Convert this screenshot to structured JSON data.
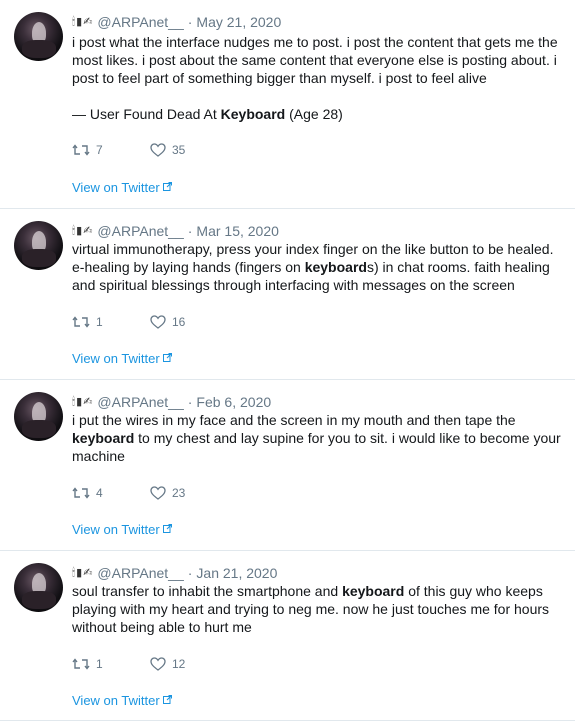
{
  "tweets": [
    {
      "handle": "@ARPAnet__",
      "separator": "·",
      "date": "May 21, 2020",
      "emoji_icons": [
        "candle-icon",
        "battery-icon",
        "tape-icon"
      ],
      "paragraphs": [
        [
          {
            "t": "i post what the interface nudges me to post. i post the content that gets me the most likes. i post about the same content that everyone else is posting about. i post to feel part of something bigger than myself. i post to feel alive"
          }
        ],
        [
          {
            "t": "— User Found Dead At "
          },
          {
            "t": "Keyboard",
            "b": true
          },
          {
            "t": " (Age 28)"
          }
        ]
      ],
      "retweets": "7",
      "likes": "35",
      "view_link": "View on Twitter"
    },
    {
      "handle": "@ARPAnet__",
      "separator": "·",
      "date": "Mar 15, 2020",
      "emoji_icons": [
        "candle-icon",
        "battery-icon",
        "tape-icon"
      ],
      "paragraphs": [
        [
          {
            "t": "virtual immunotherapy, press your index finger on the like button to be healed. e-healing by laying hands (fingers on "
          },
          {
            "t": "keyboard",
            "b": true
          },
          {
            "t": "s) in chat rooms. faith healing and spiritual blessings through interfacing with messages on the screen"
          }
        ]
      ],
      "retweets": "1",
      "likes": "16",
      "view_link": "View on Twitter"
    },
    {
      "handle": "@ARPAnet__",
      "separator": "·",
      "date": "Feb 6, 2020",
      "emoji_icons": [
        "candle-icon",
        "battery-icon",
        "tape-icon"
      ],
      "paragraphs": [
        [
          {
            "t": "i put the wires in my face and the screen in my mouth and then tape the "
          },
          {
            "t": "keyboard",
            "b": true
          },
          {
            "t": " to my chest and lay supine for you to sit. i would like to become your machine"
          }
        ]
      ],
      "retweets": "4",
      "likes": "23",
      "view_link": "View on Twitter"
    },
    {
      "handle": "@ARPAnet__",
      "separator": "·",
      "date": "Jan 21, 2020",
      "emoji_icons": [
        "candle-icon",
        "battery-icon",
        "tape-icon"
      ],
      "paragraphs": [
        [
          {
            "t": "soul transfer to inhabit the smartphone and "
          },
          {
            "t": "keyboard",
            "b": true
          },
          {
            "t": " of this guy who keeps playing with my heart and trying to neg me. now he just touches me for hours without being able to hurt me"
          }
        ]
      ],
      "retweets": "1",
      "likes": "12",
      "view_link": "View on Twitter"
    }
  ],
  "colors": {
    "link": "#1b95e0",
    "meta": "#657786",
    "text": "#14171a",
    "divider": "#e1e8ed"
  }
}
